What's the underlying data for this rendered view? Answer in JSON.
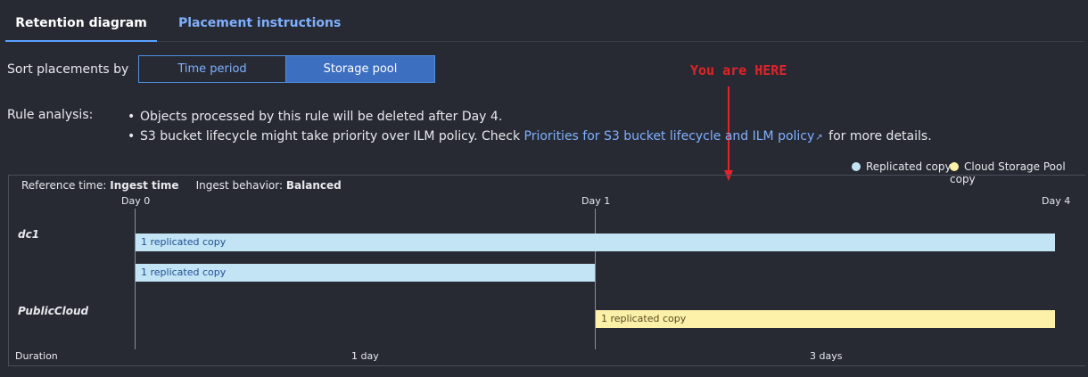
{
  "tabs": [
    {
      "label": "Retention diagram",
      "active": true
    },
    {
      "label": "Placement instructions",
      "active": false
    }
  ],
  "sort": {
    "label": "Sort placements by",
    "options": [
      "Time period",
      "Storage pool"
    ],
    "selected": "Storage pool"
  },
  "rule_analysis": {
    "label": "Rule analysis:",
    "items": [
      "Objects processed by this rule will be deleted after Day 4.",
      {
        "prefix": "S3 bucket lifecycle might take priority over ILM policy. Check ",
        "link": "Priorities for S3 bucket lifecycle and ILM policy",
        "suffix": " for more details."
      }
    ]
  },
  "annotation": "You are HERE",
  "legend": [
    {
      "label": "Replicated copy",
      "color": "#c3e4f4"
    },
    {
      "label": "Cloud Storage Pool copy",
      "color": "#fdf0a8"
    }
  ],
  "diagram": {
    "reference_time_label": "Reference time:",
    "reference_time_value": "Ingest time",
    "ingest_behavior_label": "Ingest behavior:",
    "ingest_behavior_value": "Balanced",
    "days": [
      "Day 0",
      "Day 1",
      "Day 4"
    ],
    "pools": [
      {
        "name": "dc1",
        "bars": [
          {
            "label": "1 replicated copy",
            "from_day": 0,
            "to_day": 4,
            "type": "replicated"
          },
          {
            "label": "1 replicated copy",
            "from_day": 0,
            "to_day": 1,
            "type": "replicated"
          }
        ]
      },
      {
        "name": "PublicCloud",
        "bars": [
          {
            "label": "1 replicated copy",
            "from_day": 1,
            "to_day": 4,
            "type": "cloud"
          }
        ]
      }
    ],
    "duration_label": "Duration",
    "durations": [
      "1 day",
      "3 days"
    ]
  },
  "colors": {
    "accent": "#4f8fe0",
    "annotation": "#e0242a",
    "background": "#272a33"
  }
}
